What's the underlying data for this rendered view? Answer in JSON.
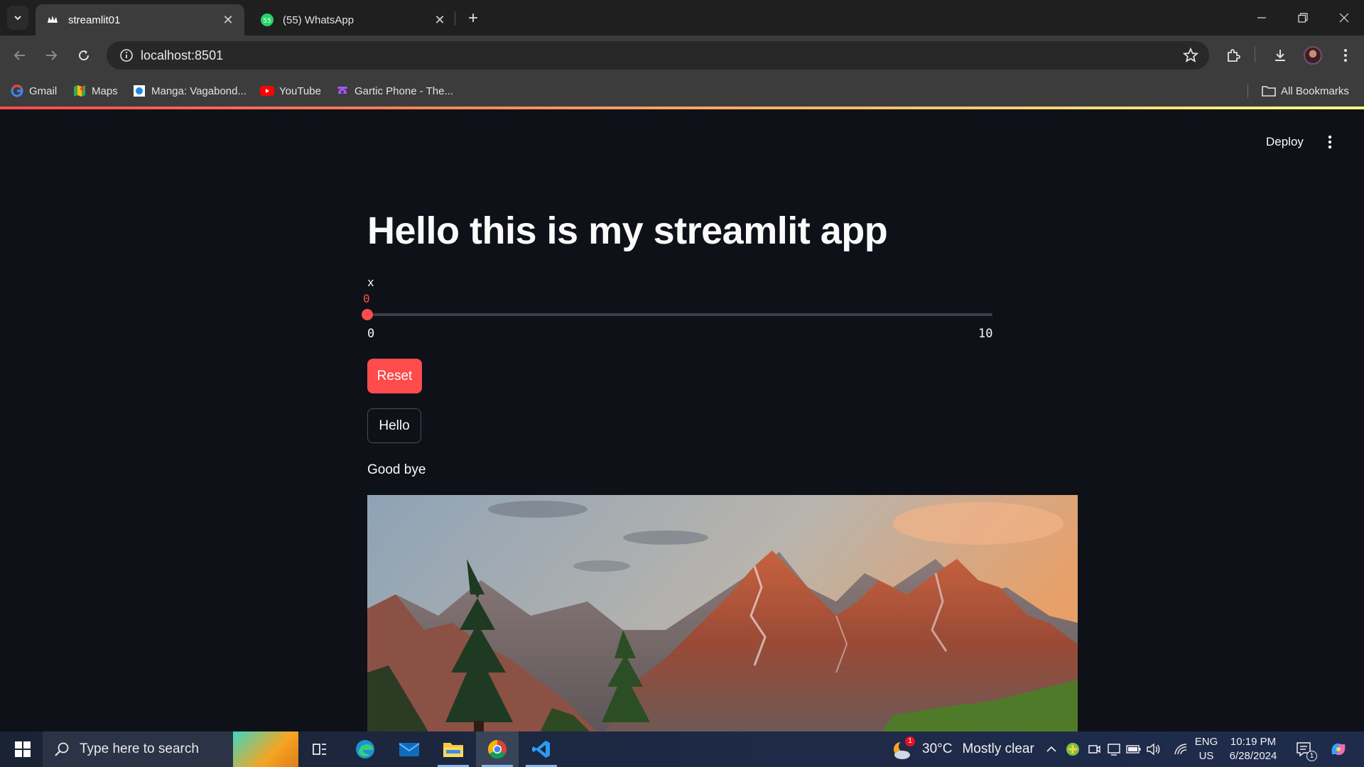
{
  "browser": {
    "tabs": [
      {
        "title": "streamlit01",
        "icon": "streamlit-crown-icon",
        "active": true
      },
      {
        "title": "(55) WhatsApp",
        "icon": "whatsapp-icon",
        "active": false
      }
    ],
    "url": "localhost:8501",
    "bookmarks": [
      {
        "label": "Gmail",
        "icon": "google-icon"
      },
      {
        "label": "Maps",
        "icon": "maps-icon"
      },
      {
        "label": "Manga: Vagabond...",
        "icon": "manga-icon"
      },
      {
        "label": "YouTube",
        "icon": "youtube-icon"
      },
      {
        "label": "Gartic Phone - The...",
        "icon": "gartic-phone-icon"
      }
    ],
    "all_bookmarks_label": "All Bookmarks"
  },
  "app": {
    "deploy_label": "Deploy",
    "title": "Hello this is my streamlit app",
    "slider": {
      "label": "x",
      "value": 0,
      "min": 0,
      "max": 10,
      "value_text": "0",
      "min_text": "0",
      "max_text": "10"
    },
    "reset_label": "Reset",
    "hello_label": "Hello",
    "text": "Good bye",
    "image_subject": "mountain landscape at sunset with pine trees"
  },
  "taskbar": {
    "search_placeholder": "Type here to search",
    "weather": {
      "temp": "30°C",
      "condition": "Mostly clear",
      "badge": "1"
    },
    "language": {
      "line1": "ENG",
      "line2": "US"
    },
    "clock": {
      "time": "10:19 PM",
      "date": "6/28/2024"
    },
    "notification_count": "1"
  },
  "colors": {
    "accent": "#ff4b4b",
    "background": "#0e1117",
    "chrome": "#3c3c3c"
  }
}
